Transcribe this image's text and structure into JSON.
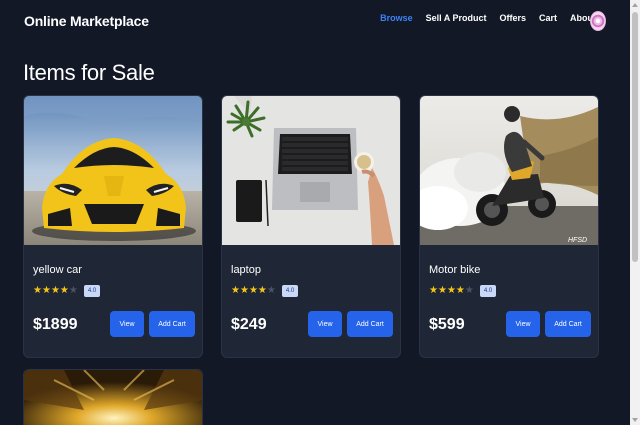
{
  "navbar": {
    "brand": "Online Marketplace",
    "links": [
      "Browse",
      "Sell A Product",
      "Offers",
      "Cart",
      "About"
    ],
    "active_index": 0
  },
  "page": {
    "title": "Items for Sale"
  },
  "products": [
    {
      "name": "yellow car",
      "rating": "4.0",
      "stars": 4,
      "price": "$1899",
      "view_label": "View",
      "add_label": "Add Cart",
      "image": "yellow-sports-car"
    },
    {
      "name": "laptop",
      "rating": "4.0",
      "stars": 4,
      "price": "$249",
      "view_label": "View",
      "add_label": "Add Cart",
      "image": "laptop-on-desk"
    },
    {
      "name": "Motor bike",
      "rating": "4.0",
      "stars": 4,
      "price": "$599",
      "view_label": "View",
      "add_label": "Add Cart",
      "image": "motorbike-burnout"
    },
    {
      "image": "golden-forest-road"
    }
  ],
  "colors": {
    "background": "#121826",
    "card": "#1f2737",
    "accent": "#2563eb",
    "active_link": "#3b82f6",
    "star": "#f5c518"
  }
}
